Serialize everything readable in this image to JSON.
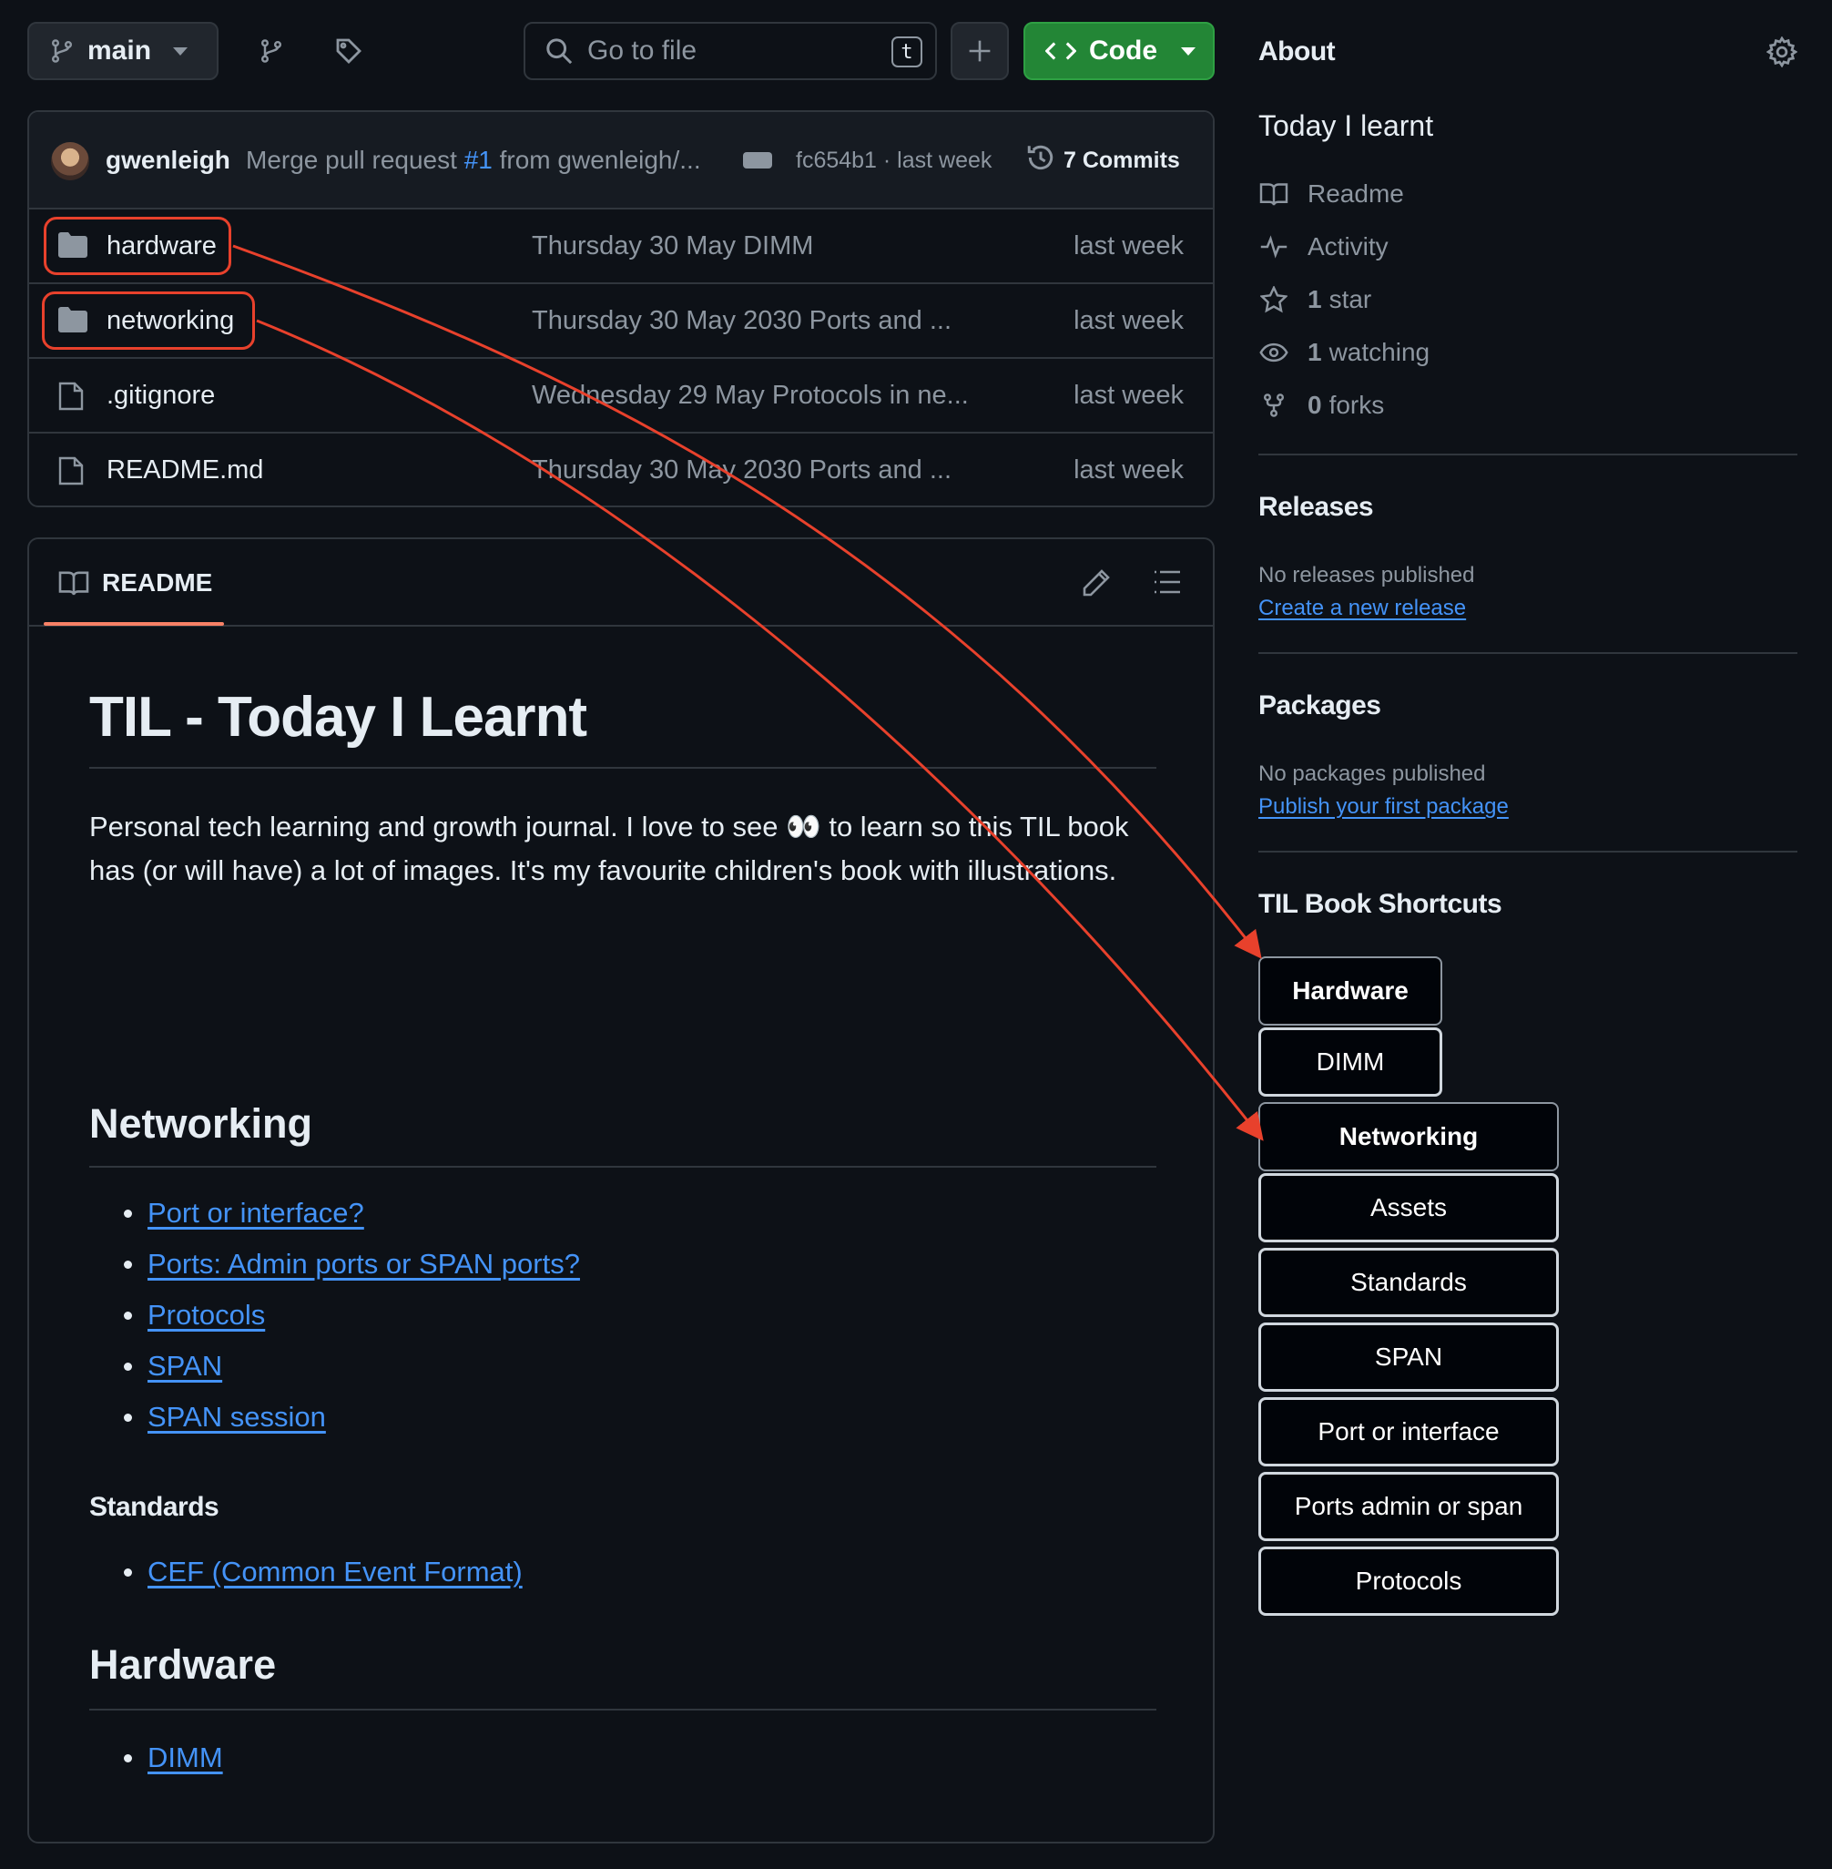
{
  "toolbar": {
    "branch": "main",
    "search_placeholder": "Go to file",
    "search_shortcut": "t",
    "code_label": "Code"
  },
  "commit": {
    "author": "gwenleigh",
    "message_prefix": "Merge pull request",
    "pr_number": "#1",
    "message_suffix": "from gwenleigh/...",
    "sha_time": "fc654b1 · last week",
    "commits": "7 Commits"
  },
  "files": [
    {
      "name": "hardware",
      "type": "folder",
      "message": "Thursday 30 May DIMM",
      "date": "last week"
    },
    {
      "name": "networking",
      "type": "folder",
      "message": "Thursday 30 May 2030 Ports and ...",
      "date": "last week"
    },
    {
      "name": ".gitignore",
      "type": "file",
      "message": "Wednesday 29 May Protocols in ne...",
      "date": "last week"
    },
    {
      "name": "README.md",
      "type": "file",
      "message": "Thursday 30 May 2030 Ports and ...",
      "date": "last week"
    }
  ],
  "readme": {
    "tab_label": "README",
    "title": "TIL - Today I Learnt",
    "intro": "Personal tech learning and growth journal. I love to see 👀 to learn so this TIL book has (or will have) a lot of images. It's my favourite children's book with illustrations.",
    "networking_heading": "Networking",
    "networking_links": [
      "Port or interface?",
      "Ports: Admin ports or SPAN ports?",
      "Protocols",
      "SPAN",
      "SPAN session"
    ],
    "standards_heading": "Standards",
    "standards_links": [
      "CEF (Common Event Format)"
    ],
    "hardware_heading": "Hardware",
    "hardware_links": [
      "DIMM"
    ]
  },
  "sidebar": {
    "about_heading": "About",
    "description": "Today I learnt",
    "meta": [
      {
        "icon": "book-icon",
        "count": "",
        "label": "Readme"
      },
      {
        "icon": "pulse-icon",
        "count": "",
        "label": "Activity"
      },
      {
        "icon": "star-icon",
        "count": "1",
        "label": "star"
      },
      {
        "icon": "eye-icon",
        "count": "1",
        "label": "watching"
      },
      {
        "icon": "fork-icon",
        "count": "0",
        "label": "forks"
      }
    ],
    "releases_heading": "Releases",
    "releases_text": "No releases published",
    "releases_link": "Create a new release",
    "packages_heading": "Packages",
    "packages_text": "No packages published",
    "packages_link": "Publish your first package",
    "shortcuts_heading": "TIL Book Shortcuts",
    "shortcuts": [
      {
        "label": "Hardware",
        "heading": true
      },
      {
        "label": "DIMM",
        "heading": false
      },
      {
        "label": "Networking",
        "heading": true
      },
      {
        "label": "Assets",
        "heading": false
      },
      {
        "label": "Standards",
        "heading": false
      },
      {
        "label": "SPAN",
        "heading": false
      },
      {
        "label": "Port or interface",
        "heading": false
      },
      {
        "label": "Ports admin or span",
        "heading": false
      },
      {
        "label": "Protocols",
        "heading": false
      }
    ]
  },
  "colors": {
    "background": "#0d1117",
    "accent_link": "#4493f8",
    "code_button": "#238636",
    "annotation": "#e8412c"
  }
}
